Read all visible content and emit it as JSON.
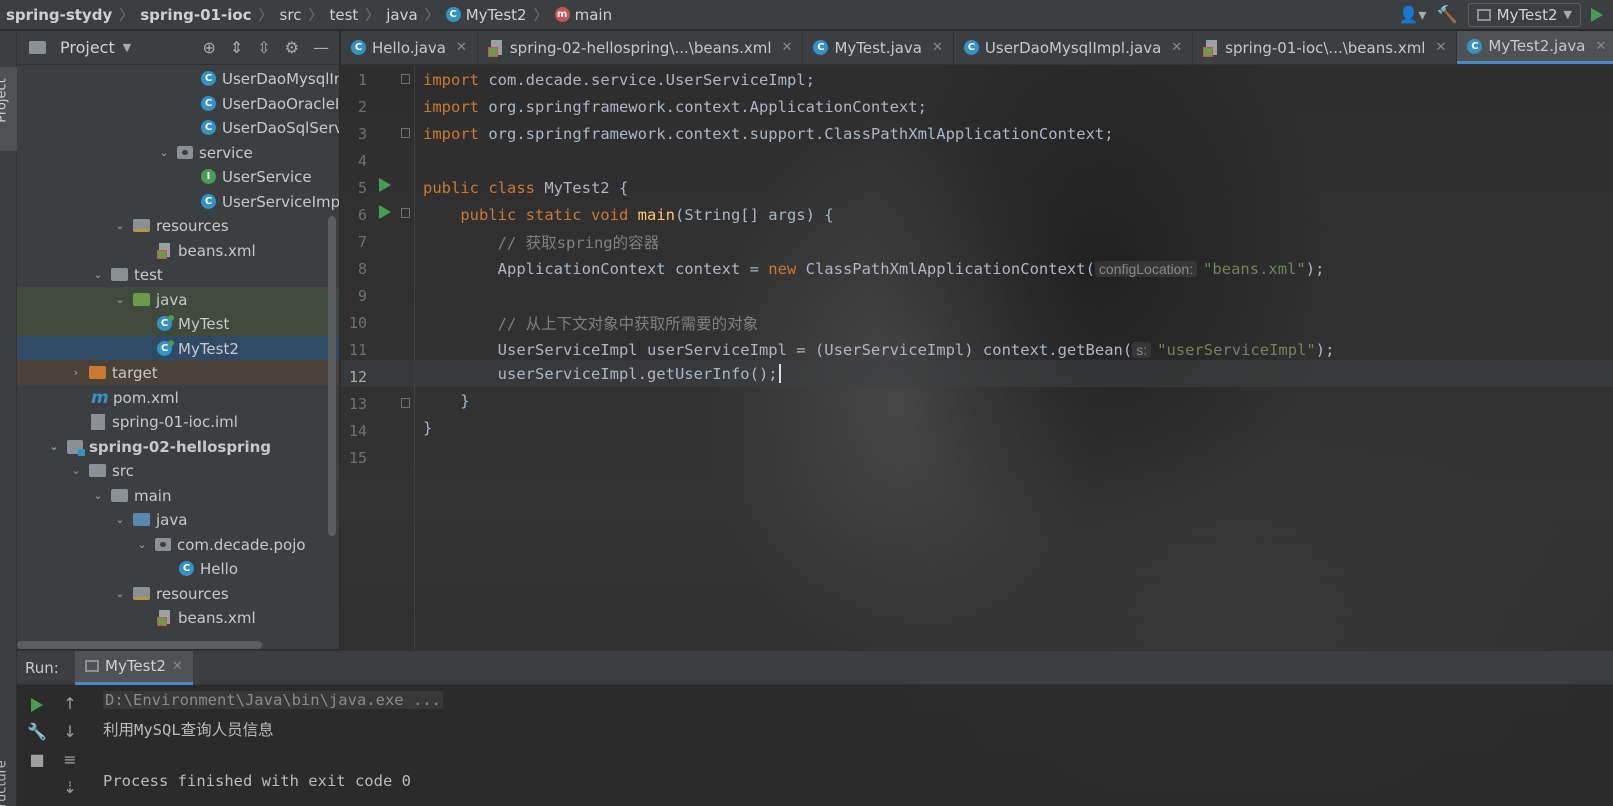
{
  "breadcrumb": {
    "items": [
      "spring-stydy",
      "spring-01-ioc",
      "src",
      "test",
      "java",
      "MyTest2",
      "main"
    ]
  },
  "toolbar": {
    "run_config": "MyTest2"
  },
  "sidebar": {
    "project_label": "Project",
    "structure_label": "Structure"
  },
  "project_panel": {
    "title": "Project",
    "tree": [
      {
        "label": "UserDaoMysqlImpl",
        "kind": "class"
      },
      {
        "label": "UserDaoOracleImpl",
        "kind": "class"
      },
      {
        "label": "UserDaoSqlServerImpl",
        "kind": "class"
      },
      {
        "label": "service",
        "kind": "package"
      },
      {
        "label": "UserService",
        "kind": "interface"
      },
      {
        "label": "UserServiceImpl",
        "kind": "class"
      },
      {
        "label": "resources",
        "kind": "folder-res"
      },
      {
        "label": "beans.xml",
        "kind": "xml"
      },
      {
        "label": "test",
        "kind": "folder"
      },
      {
        "label": "java",
        "kind": "folder-green"
      },
      {
        "label": "MyTest",
        "kind": "class-run"
      },
      {
        "label": "MyTest2",
        "kind": "class-run"
      },
      {
        "label": "target",
        "kind": "folder-orange"
      },
      {
        "label": "pom.xml",
        "kind": "maven"
      },
      {
        "label": "spring-01-ioc.iml",
        "kind": "iml"
      },
      {
        "label": "spring-02-hellospring",
        "kind": "module"
      },
      {
        "label": "src",
        "kind": "folder"
      },
      {
        "label": "main",
        "kind": "folder"
      },
      {
        "label": "java",
        "kind": "folder-blue"
      },
      {
        "label": "com.decade.pojo",
        "kind": "package"
      },
      {
        "label": "Hello",
        "kind": "class"
      },
      {
        "label": "resources",
        "kind": "folder-res"
      },
      {
        "label": "beans.xml",
        "kind": "xml"
      }
    ]
  },
  "tabs": [
    {
      "label": "Hello.java",
      "icon": "class-icon"
    },
    {
      "label": "spring-02-hellospring\\...\\beans.xml",
      "icon": "xml-icon"
    },
    {
      "label": "MyTest.java",
      "icon": "class-icon"
    },
    {
      "label": "UserDaoMysqlImpl.java",
      "icon": "class-icon"
    },
    {
      "label": "spring-01-ioc\\...\\beans.xml",
      "icon": "xml-icon"
    },
    {
      "label": "MyTest2.java",
      "icon": "class-icon"
    }
  ],
  "editor": {
    "line_numbers": [
      "1",
      "2",
      "3",
      "4",
      "5",
      "6",
      "7",
      "8",
      "9",
      "10",
      "11",
      "12",
      "13",
      "14",
      "15"
    ],
    "code": {
      "l1_kw": "import",
      "l1_rest": " com.decade.service.UserServiceImpl;",
      "l2_kw": "import",
      "l2_rest": " org.springframework.context.ApplicationContext;",
      "l3_kw": "import",
      "l3_rest": " org.springframework.context.support.ClassPathXmlApplicationContext;",
      "l5_kw": "public class",
      "l5_rest": " MyTest2 {",
      "l6_indent": "    ",
      "l6_kw": "public static void",
      "l6_fn": "main",
      "l6_rest": "(String[] args) {",
      "l7_indent": "        ",
      "l7_cmt": "// 获取spring的容器",
      "l8_indent": "        ",
      "l8_a": "ApplicationContext context = ",
      "l8_kw": "new",
      "l8_b": " ClassPathXmlApplicationContext(",
      "l8_hint": "configLocation:",
      "l8_str": "\"beans.xml\"",
      "l8_end": ");",
      "l10_indent": "        ",
      "l10_cmt": "// 从上下文对象中获取所需要的对象",
      "l11_indent": "        ",
      "l11_a": "UserServiceImpl userServiceImpl = (UserServiceImpl) context.getBean(",
      "l11_hint": "s:",
      "l11_str": "\"userServiceImpl\"",
      "l11_end": ");",
      "l12_indent": "        ",
      "l12_a": "userServiceImpl.getUserInfo();",
      "l13": "    }",
      "l14": "}"
    }
  },
  "run_panel": {
    "label": "Run:",
    "tab": "MyTest2",
    "console": [
      "D:\\Environment\\Java\\bin\\java.exe ...",
      "利用MySQL查询人员信息",
      "",
      "Process finished with exit code 0"
    ]
  }
}
